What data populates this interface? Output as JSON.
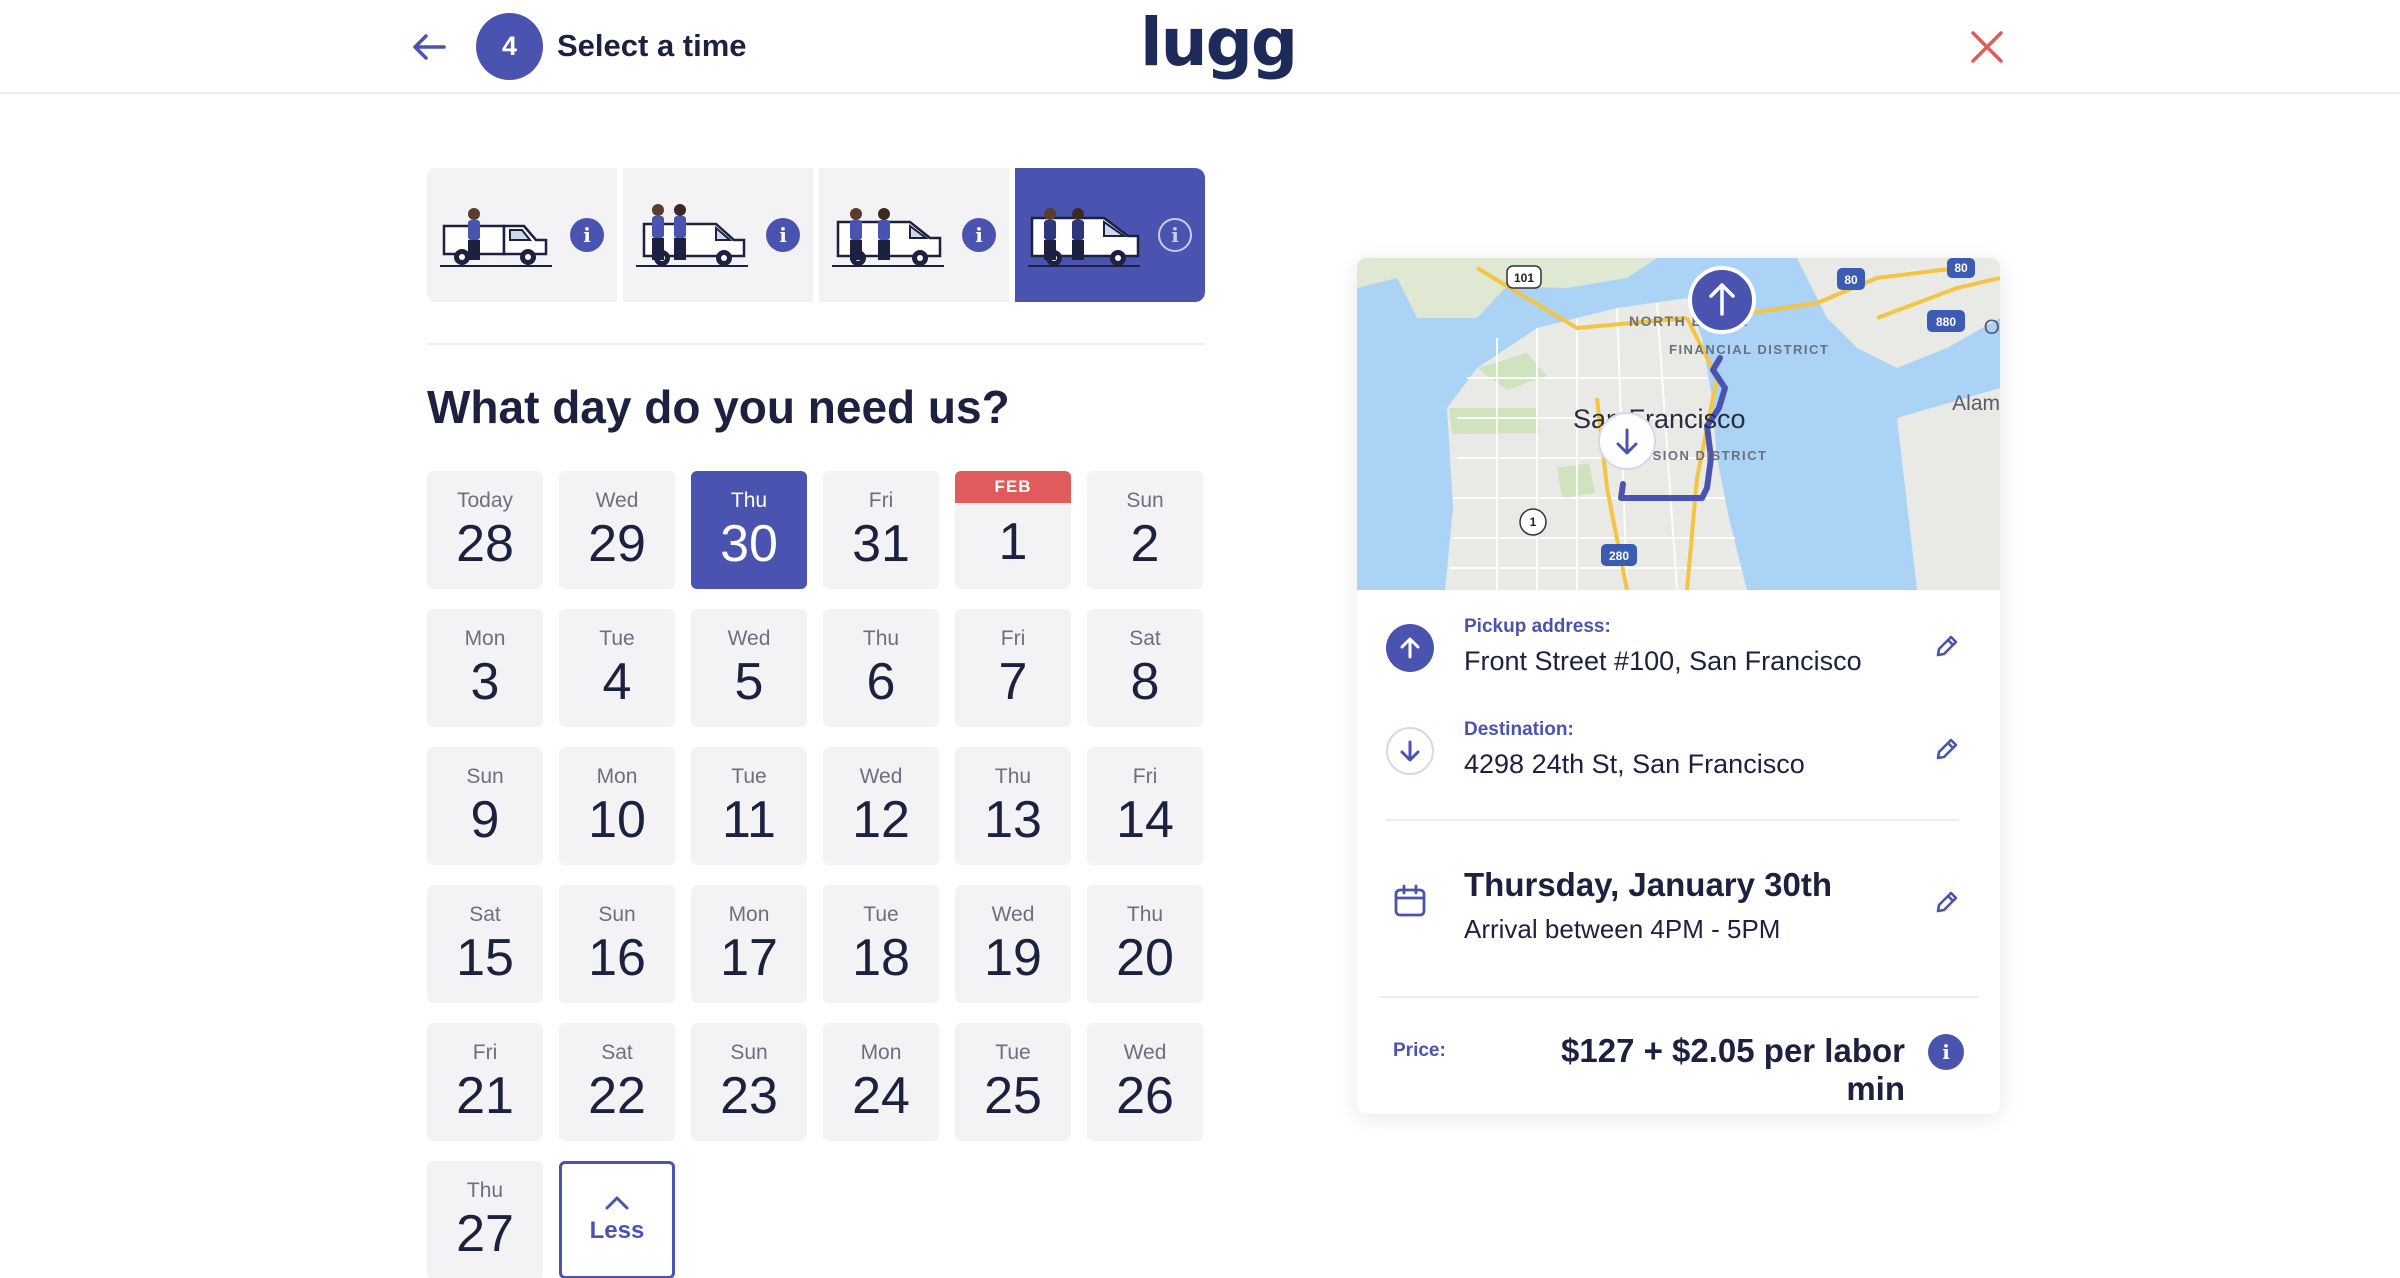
{
  "header": {
    "step_number": "4",
    "step_title": "Select a time",
    "logo": "lugg"
  },
  "colors": {
    "accent": "#4b53b0",
    "month_band": "#e05b5b",
    "close": "#e05b5b",
    "tile_bg": "#f3f3f5"
  },
  "vehicles": [
    {
      "name": "pickup-truck",
      "info": "i",
      "selected": false
    },
    {
      "name": "cargo-van",
      "info": "i",
      "selected": false
    },
    {
      "name": "box-van",
      "info": "i",
      "selected": false
    },
    {
      "name": "large-van",
      "info": "i",
      "selected": true
    }
  ],
  "calendar": {
    "question": "What day do you need us?",
    "days": [
      {
        "dow": "Today",
        "num": "28"
      },
      {
        "dow": "Wed",
        "num": "29"
      },
      {
        "dow": "Thu",
        "num": "30",
        "selected": true
      },
      {
        "dow": "Fri",
        "num": "31"
      },
      {
        "dow": "",
        "num": "1",
        "month": "FEB"
      },
      {
        "dow": "Sun",
        "num": "2"
      },
      {
        "dow": "Mon",
        "num": "3"
      },
      {
        "dow": "Tue",
        "num": "4"
      },
      {
        "dow": "Wed",
        "num": "5"
      },
      {
        "dow": "Thu",
        "num": "6"
      },
      {
        "dow": "Fri",
        "num": "7"
      },
      {
        "dow": "Sat",
        "num": "8"
      },
      {
        "dow": "Sun",
        "num": "9"
      },
      {
        "dow": "Mon",
        "num": "10"
      },
      {
        "dow": "Tue",
        "num": "11"
      },
      {
        "dow": "Wed",
        "num": "12"
      },
      {
        "dow": "Thu",
        "num": "13"
      },
      {
        "dow": "Fri",
        "num": "14"
      },
      {
        "dow": "Sat",
        "num": "15"
      },
      {
        "dow": "Sun",
        "num": "16"
      },
      {
        "dow": "Mon",
        "num": "17"
      },
      {
        "dow": "Tue",
        "num": "18"
      },
      {
        "dow": "Wed",
        "num": "19"
      },
      {
        "dow": "Thu",
        "num": "20"
      },
      {
        "dow": "Fri",
        "num": "21"
      },
      {
        "dow": "Sat",
        "num": "22"
      },
      {
        "dow": "Sun",
        "num": "23"
      },
      {
        "dow": "Mon",
        "num": "24"
      },
      {
        "dow": "Tue",
        "num": "25"
      },
      {
        "dow": "Wed",
        "num": "26"
      },
      {
        "dow": "Thu",
        "num": "27"
      }
    ],
    "less_label": "Less"
  },
  "map": {
    "city_label": "San Francisco",
    "labels": [
      "NORTH BEACH",
      "FINANCIAL DISTRICT",
      "MISSION DISTRICT",
      "Alam",
      "O"
    ],
    "shields": [
      "101",
      "80",
      "80",
      "880",
      "1",
      "280"
    ]
  },
  "summary": {
    "pickup_label": "Pickup address:",
    "pickup_value": "Front Street #100, San Francisco",
    "destination_label": "Destination:",
    "destination_value": "4298 24th St, San Francisco",
    "date_title": "Thursday, January 30th",
    "date_sub": "Arrival between 4PM - 5PM",
    "price_label": "Price:",
    "price_value": "$127 + $2.05 per labor min",
    "price_info": "i"
  }
}
